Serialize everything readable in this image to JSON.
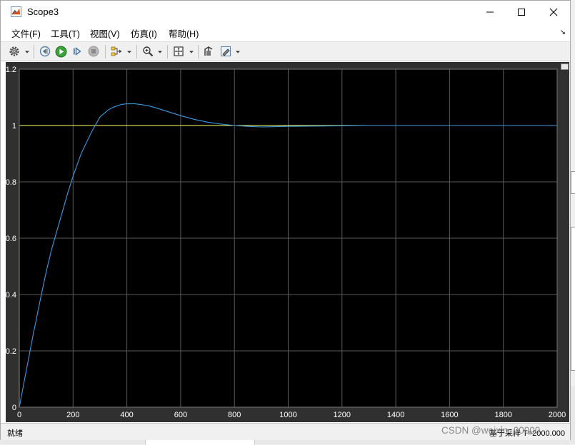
{
  "window": {
    "title": "Scope3",
    "minimize_glyph": "—",
    "maximize_glyph": "☐",
    "close_glyph": "✕"
  },
  "menu": {
    "items": [
      {
        "label": "文件(F)"
      },
      {
        "label": "工具(T)"
      },
      {
        "label": "视图(V)"
      },
      {
        "label": "仿真(I)"
      },
      {
        "label": "帮助(H)"
      }
    ],
    "overflow_glyph": "↘"
  },
  "toolbar": {
    "icons": [
      "gear-icon",
      "step-back-icon",
      "run-icon",
      "step-forward-icon",
      "stop-icon",
      "signal-selector-icon",
      "zoom-icon",
      "autoscale-icon",
      "highlight-icon",
      "style-icon"
    ]
  },
  "colors": {
    "background": "#000000",
    "frame": "#303030",
    "grid": "#5a5a5a",
    "axis_text": "#ffffff",
    "reference": "#ffff66",
    "response": "#3a9ae0"
  },
  "chart_data": {
    "type": "line",
    "x_ticks": [
      "0",
      "200",
      "400",
      "600",
      "800",
      "1000",
      "1200",
      "1400",
      "1600",
      "1800",
      "2000"
    ],
    "y_ticks": [
      "0",
      "0.2",
      "0.4",
      "0.6",
      "0.8",
      "1",
      "1.2"
    ],
    "xlim": [
      0,
      2000
    ],
    "ylim": [
      0,
      1.2
    ],
    "grid": true,
    "series": [
      {
        "color": "#ffff66",
        "x": [
          0,
          0,
          2000
        ],
        "y": [
          0,
          1,
          1
        ]
      },
      {
        "color": "#3a9ae0",
        "x": [
          0,
          20,
          50,
          80,
          100,
          120,
          150,
          180,
          200,
          230,
          250,
          270,
          300,
          330,
          350,
          380,
          400,
          430,
          450,
          480,
          500,
          550,
          600,
          650,
          700,
          750,
          800,
          850,
          900,
          950,
          1000,
          1100,
          1200,
          1300,
          1400,
          1500,
          1600,
          1700,
          1800,
          1900,
          2000
        ],
        "y": [
          0,
          0.1,
          0.25,
          0.39,
          0.48,
          0.56,
          0.66,
          0.76,
          0.82,
          0.9,
          0.94,
          0.98,
          1.03,
          1.055,
          1.065,
          1.075,
          1.077,
          1.077,
          1.075,
          1.07,
          1.065,
          1.05,
          1.035,
          1.022,
          1.012,
          1.005,
          1.0,
          0.997,
          0.995,
          0.996,
          0.997,
          0.998,
          0.999,
          1.0,
          1.0,
          1.0,
          1.0,
          1.0,
          1.0,
          1.0,
          1.0
        ]
      }
    ]
  },
  "status": {
    "left": "就绪",
    "right": "基于采样 T=2000.000"
  },
  "watermark": "CSDN @weixin_00000"
}
